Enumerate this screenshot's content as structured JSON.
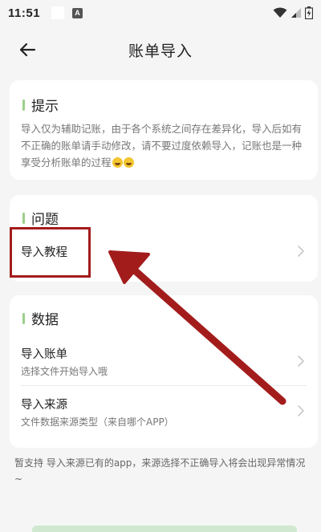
{
  "status_bar": {
    "time": "11:51",
    "a_icon": "A"
  },
  "header": {
    "title": "账单导入"
  },
  "tips": {
    "title": "提示",
    "text": "导入仅为辅助记账，由于各个系统之间存在差异化，导入后如有不正确的账单请手动修改，请不要过度依赖导入，记账也是一种享受分析账单的过程"
  },
  "question": {
    "title": "问题",
    "items": [
      {
        "label": "导入教程"
      }
    ]
  },
  "data_section": {
    "title": "数据",
    "items": [
      {
        "label": "导入账单",
        "sub": "选择文件开始导入哦"
      },
      {
        "label": "导入来源",
        "sub": "文件数据来源类型（来自哪个APP）"
      }
    ]
  },
  "footer": {
    "note": "暂支持 导入来源已有的app，来源选择不正确导入将会出现异常情况~"
  },
  "colors": {
    "accent": "#9ccf8a",
    "annotation": "#a31c1c"
  }
}
